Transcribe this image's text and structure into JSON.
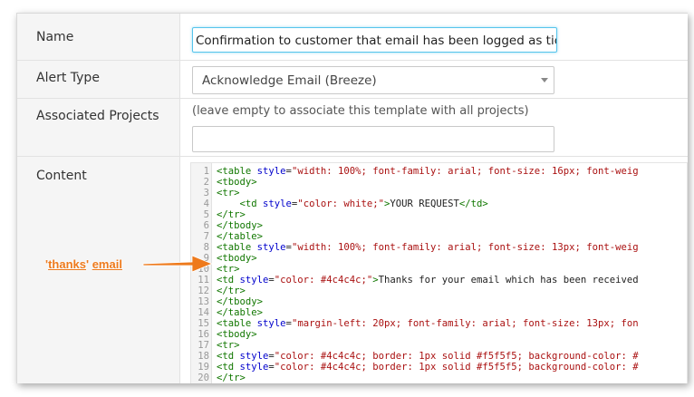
{
  "form": {
    "name": {
      "label": "Name",
      "value": "Confirmation to customer that email has been logged as ticket"
    },
    "alert_type": {
      "label": "Alert Type",
      "selected": "Acknowledge Email (Breeze)"
    },
    "associated_projects": {
      "label": "Associated Projects",
      "hint": "(leave empty to associate this template with all projects)",
      "value": ""
    },
    "content": {
      "label": "Content",
      "lines": [
        [
          [
            "tag",
            "<table "
          ],
          [
            "attr",
            "style"
          ],
          [
            "txt",
            "="
          ],
          [
            "str",
            "\"width: 100%; font-family: arial; font-size: 16px; font-weig"
          ]
        ],
        [
          [
            "tag",
            "<tbody>"
          ]
        ],
        [
          [
            "tag",
            "<tr>"
          ]
        ],
        [
          [
            "txt",
            "    "
          ],
          [
            "tag",
            "<td "
          ],
          [
            "attr",
            "style"
          ],
          [
            "txt",
            "="
          ],
          [
            "str",
            "\"color: white;\""
          ],
          [
            "tag",
            ">"
          ],
          [
            "txt",
            "YOUR REQUEST"
          ],
          [
            "tag",
            "</td>"
          ]
        ],
        [
          [
            "tag",
            "</tr>"
          ]
        ],
        [
          [
            "tag",
            "</tbody>"
          ]
        ],
        [
          [
            "tag",
            "</table>"
          ]
        ],
        [
          [
            "tag",
            "<table "
          ],
          [
            "attr",
            "style"
          ],
          [
            "txt",
            "="
          ],
          [
            "str",
            "\"width: 100%; font-family: arial; font-size: 13px; font-weig"
          ]
        ],
        [
          [
            "tag",
            "<tbody>"
          ]
        ],
        [
          [
            "tag",
            "<tr>"
          ]
        ],
        [
          [
            "tag",
            "<td "
          ],
          [
            "attr",
            "style"
          ],
          [
            "txt",
            "="
          ],
          [
            "str",
            "\"color: #4c4c4c;\""
          ],
          [
            "tag",
            ">"
          ],
          [
            "txt",
            "Thanks for your email which has been received"
          ]
        ],
        [
          [
            "tag",
            "</tr>"
          ]
        ],
        [
          [
            "tag",
            "</tbody>"
          ]
        ],
        [
          [
            "tag",
            "</table>"
          ]
        ],
        [
          [
            "tag",
            "<table "
          ],
          [
            "attr",
            "style"
          ],
          [
            "txt",
            "="
          ],
          [
            "str",
            "\"margin-left: 20px; font-family: arial; font-size: 13px; fon"
          ]
        ],
        [
          [
            "tag",
            "<tbody>"
          ]
        ],
        [
          [
            "tag",
            "<tr>"
          ]
        ],
        [
          [
            "tag",
            "<td "
          ],
          [
            "attr",
            "style"
          ],
          [
            "txt",
            "="
          ],
          [
            "str",
            "\"color: #4c4c4c; border: 1px solid #f5f5f5; background-color: #"
          ]
        ],
        [
          [
            "tag",
            "<td "
          ],
          [
            "attr",
            "style"
          ],
          [
            "txt",
            "="
          ],
          [
            "str",
            "\"color: #4c4c4c; border: 1px solid #f5f5f5; background-color: #"
          ]
        ],
        [
          [
            "tag",
            "</tr>"
          ]
        ]
      ]
    }
  },
  "annotation": {
    "quote_open": "'",
    "word1": "thanks",
    "quote_close": "' ",
    "word2": "email"
  },
  "colors": {
    "annotation": "#ee7a1c",
    "focus_border": "#55c4ec",
    "tag": "#117700",
    "attribute": "#0000cc",
    "string": "#aa1111"
  }
}
